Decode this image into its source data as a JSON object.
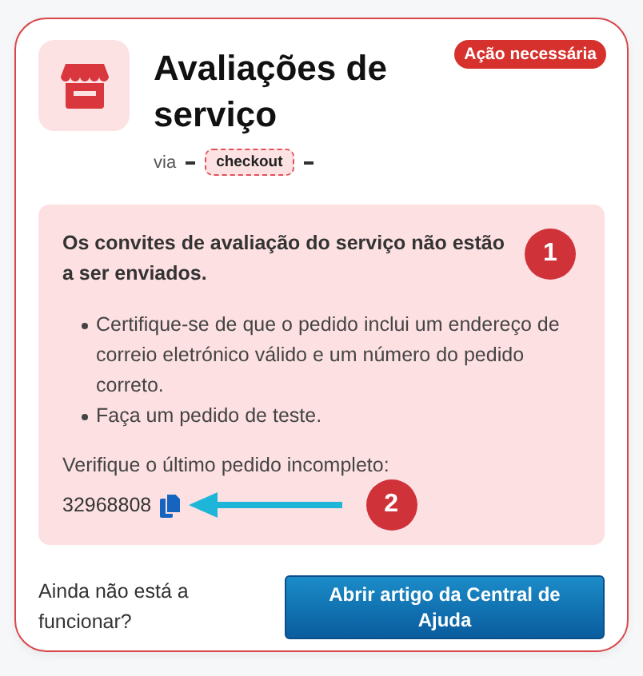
{
  "card": {
    "title": "Avaliações de serviço",
    "badge": "Ação necessária",
    "via_label": "via",
    "via_tag": "checkout"
  },
  "alert": {
    "heading": "Os convites de avaliação do serviço não estão a ser enviados.",
    "bullets": [
      "Certifique-se de que o pedido inclui um endereço de correio eletrónico válido e um número do pedido correto.",
      "Faça um pedido de teste."
    ],
    "check_label": "Verifique o último pedido incompleto:",
    "order_number": "32968808"
  },
  "annotations": [
    {
      "number": "1"
    },
    {
      "number": "2"
    }
  ],
  "footer": {
    "question": "Ainda não está a funcionar?",
    "button": "Abrir artigo da Central de Ajuda"
  }
}
